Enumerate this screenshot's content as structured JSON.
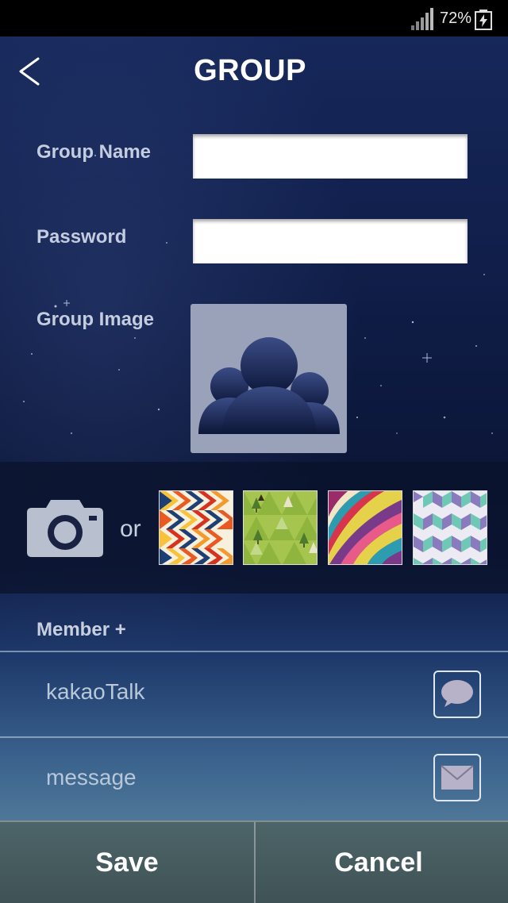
{
  "status_bar": {
    "battery_percent": "72%",
    "signal_icon": "signal-bars-icon",
    "battery_icon": "battery-charging-icon"
  },
  "header": {
    "title": "GROUP",
    "back_icon": "chevron-left-icon"
  },
  "form": {
    "group_name_label": "Group Name",
    "group_name_value": "",
    "password_label": "Password",
    "password_value": "",
    "group_image_label": "Group Image",
    "group_image_icon": "group-people-icon"
  },
  "image_picker": {
    "camera_icon": "camera-icon",
    "or_text": "or",
    "patterns": [
      "chevron-pattern",
      "triangle-trees-pattern",
      "stripes-pattern",
      "cubes-pattern"
    ]
  },
  "members": {
    "label": "Member +",
    "rows": [
      {
        "label": "kakaoTalk",
        "icon": "chat-bubble-icon"
      },
      {
        "label": "message",
        "icon": "envelope-icon"
      }
    ]
  },
  "footer": {
    "save_label": "Save",
    "cancel_label": "Cancel"
  },
  "colors": {
    "background_top": "#16275a",
    "background_bottom": "#6b91a3",
    "bottom_bar": "#4d6468",
    "label_text": "#c4cde0"
  }
}
